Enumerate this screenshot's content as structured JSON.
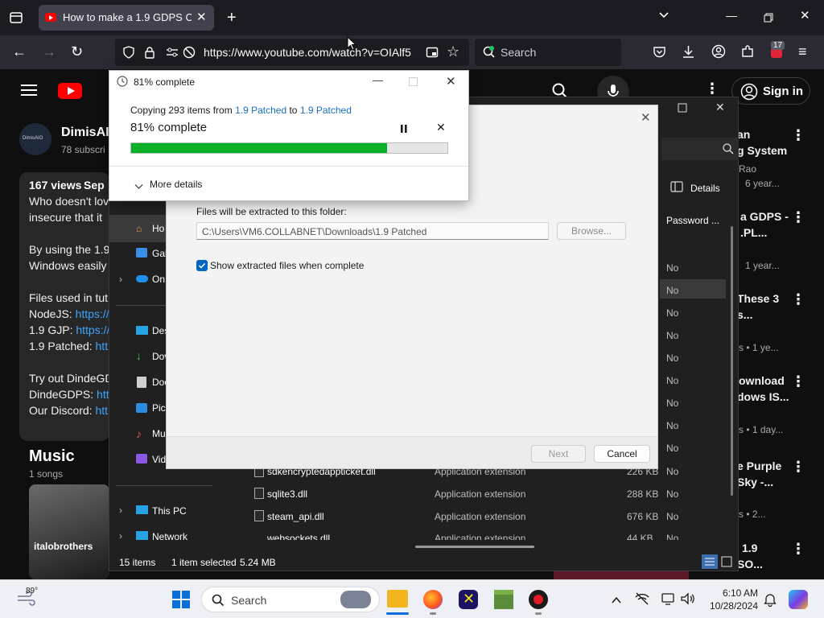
{
  "browser": {
    "tab_title": "How to make a 1.9 GDPS Client",
    "url_main": "https://www.youtube.com/watch?v=OIAlf5",
    "search_placeholder": "Search",
    "extensions_badge": "17"
  },
  "youtube": {
    "sign_in": "Sign in",
    "channel_name": "DimisAI",
    "subscribers": "78 subscri",
    "avatar_label": "DimisAIO",
    "views": "167 views",
    "date": "Sep",
    "description": [
      "Who doesn't lov",
      "insecure that it",
      "",
      "By using the 1.9",
      "Windows easily",
      "",
      "Files used in tut",
      "NodeJS: ",
      "1.9 GJP: ",
      "1.9 Patched: ",
      "",
      "Try out DindeGD",
      "DindeGDPS: ",
      "Our Discord: "
    ],
    "description_links": {
      "nodejs": "https://",
      "gjp": "https://",
      "patched": "htt",
      "dindegdps": "htt",
      "discord": "htt"
    },
    "music_title": "Music",
    "music_count": "1 songs",
    "music_art_label": "italobrothers",
    "recommendations": [
      {
        "title1": "an",
        "title2": "g System",
        "meta1": "Rao",
        "meta2": "6 year..."
      },
      {
        "title1": "a GDPS -",
        "title2": ".PL...",
        "meta1": "",
        "meta2": "1 year..."
      },
      {
        "title1": "These 3",
        "title2": "s...",
        "meta1": "",
        "meta2": "s • 1 ye..."
      },
      {
        "title1": "ownload",
        "title2": "dows IS...",
        "meta1": "",
        "meta2": "s • 1 day..."
      },
      {
        "title1": "e Purple",
        "title2": "Sky -...",
        "meta1": "",
        "meta2": "s • 2..."
      },
      {
        "title1": "1.9",
        "title2": "SO...",
        "meta1": "",
        "meta2": ""
      }
    ]
  },
  "explorer": {
    "nav_items": [
      "Ho",
      "Gal",
      "On",
      "Des",
      "Dov",
      "Doc",
      "Pic",
      "Mu",
      "Vid",
      "This PC",
      "Network"
    ],
    "details_label": "Details",
    "column_password": "Password ...",
    "password_values": [
      "No",
      "No",
      "No",
      "No",
      "No",
      "No",
      "No",
      "No",
      "No",
      "No",
      "No",
      "No",
      "No"
    ],
    "files": [
      {
        "name": "sdkencryptedappticket.dll",
        "type": "Application extension",
        "size": "226 KB",
        "pw": "No"
      },
      {
        "name": "sqlite3.dll",
        "type": "Application extension",
        "size": "288 KB",
        "pw": "No"
      },
      {
        "name": "steam_api.dll",
        "type": "Application extension",
        "size": "676 KB",
        "pw": "No"
      },
      {
        "name": "websockets.dll",
        "type": "Application extension",
        "size": "44 KB",
        "pw": "No"
      }
    ],
    "status_items": "15 items",
    "status_selected": "1 item selected",
    "status_size": "5.24 MB"
  },
  "extract": {
    "folder_label": "Files will be extracted to this folder:",
    "path_value": "C:\\Users\\VM6.COLLABNET\\Downloads\\1.9 Patched",
    "browse": "Browse...",
    "show_files": "Show extracted files when complete",
    "next": "Next",
    "cancel": "Cancel"
  },
  "progress": {
    "window_title": "81% complete",
    "copy_prefix": "Copying 293 items from ",
    "from": "1.9 Patched",
    "to_word": " to ",
    "to": "1.9 Patched",
    "heading": "81% complete",
    "percent": 81,
    "more_details": "More details",
    "bar_color": "#06b025"
  },
  "taskbar": {
    "weather_temp": "89°",
    "search_label": "Search",
    "time": "6:10 AM",
    "date": "10/28/2024"
  }
}
